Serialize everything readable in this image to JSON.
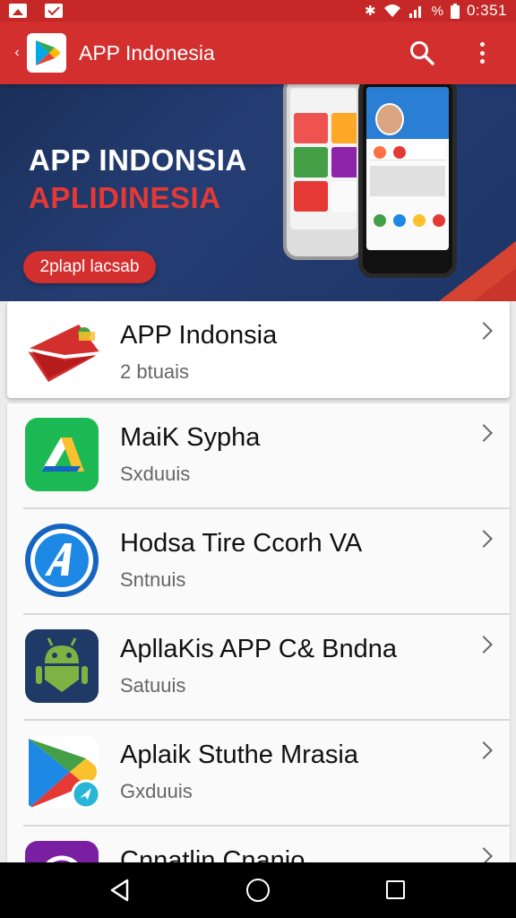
{
  "status_bar": {
    "time": "0:351",
    "battery": "%",
    "icons": [
      "image-icon",
      "mail-icon",
      "bluetooth-icon",
      "wifi-icon",
      "signal-icon",
      "battery-icon"
    ]
  },
  "app_bar": {
    "title": "APP Indonesia",
    "icons": [
      "back-icon",
      "play-store-logo",
      "search-icon",
      "more-vert-icon"
    ]
  },
  "banner": {
    "title": "APP INDONSIA",
    "subtitle": "APLIDINESIA",
    "button_label": "2plapl lacsab"
  },
  "featured": {
    "title": "APP Indonsia",
    "subtitle": "2 btuais",
    "icon": "red-envelope-icon"
  },
  "apps": [
    {
      "title": "MaiK Sypha",
      "subtitle": "Sxduuis",
      "icon": "green-drive-icon"
    },
    {
      "title": "Hodsa Tire Ccorh VA",
      "subtitle": "Sntnuis",
      "icon": "blue-a-icon"
    },
    {
      "title": "ApllaKis APP C& Bndna",
      "subtitle": "Satuuis",
      "icon": "android-icon"
    },
    {
      "title": "Aplaik Stuthe Mrasia",
      "subtitle": "Gxduuis",
      "icon": "play-triangle-icon"
    },
    {
      "title": "Cnnatlin Cnanio",
      "subtitle": "",
      "icon": "purple-circle-icon"
    }
  ],
  "colors": {
    "status_bar": "#c62828",
    "app_bar": "#d32f2f",
    "banner_bg": "#1e3566",
    "accent_red": "#e53935"
  }
}
